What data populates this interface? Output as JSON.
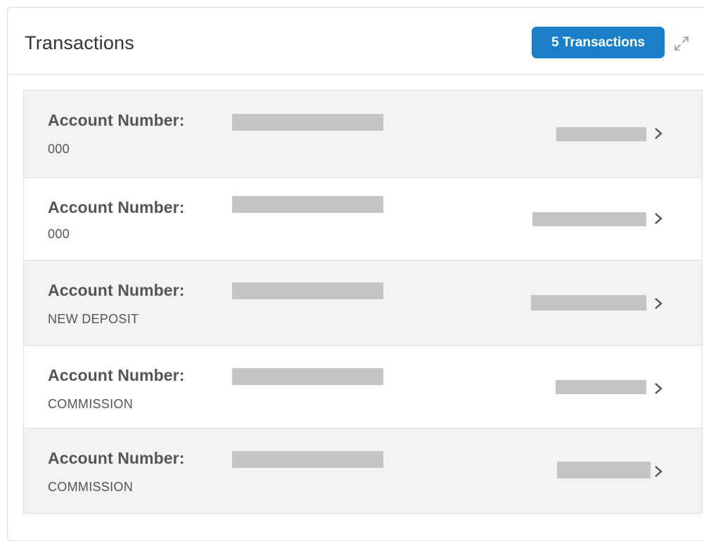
{
  "accent_color": "#1a7fc9",
  "panel": {
    "title": "Transactions",
    "count_badge": "5 Transactions",
    "expand_icon": "expand-diagonal-icon"
  },
  "transactions": [
    {
      "label": "Account Number:",
      "subtitle": "000",
      "account_redacted": true,
      "amount_redacted": true
    },
    {
      "label": "Account Number:",
      "subtitle": "000",
      "account_redacted": true,
      "amount_redacted": true
    },
    {
      "label": "Account Number:",
      "subtitle": "NEW DEPOSIT",
      "account_redacted": true,
      "amount_redacted": true
    },
    {
      "label": "Account Number:",
      "subtitle": "COMMISSION",
      "account_redacted": true,
      "amount_redacted": true
    },
    {
      "label": "Account Number:",
      "subtitle": "COMMISSION",
      "account_redacted": true,
      "amount_redacted": true
    }
  ],
  "row_chevron_icon": "chevron-right-icon"
}
